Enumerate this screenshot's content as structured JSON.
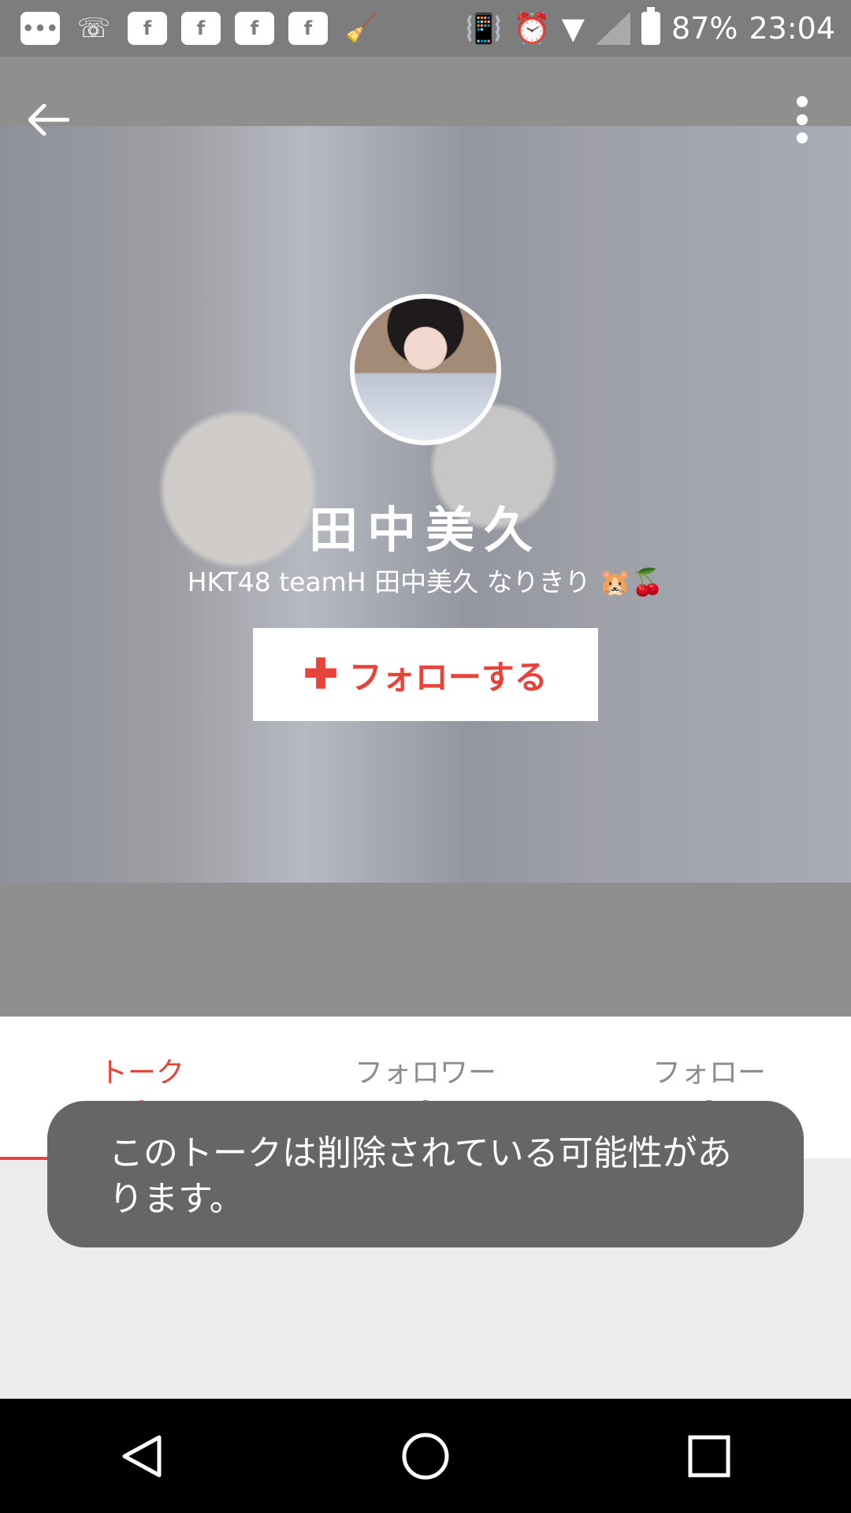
{
  "status_bar": {
    "battery": "87%",
    "time": "23:04"
  },
  "profile": {
    "name": "田中美久",
    "bio": "HKT48 teamH  田中美久 なりきり 🐹🍒",
    "follow_button": "フォローする"
  },
  "tabs": [
    {
      "label": "トーク",
      "count": "1"
    },
    {
      "label": "フォロワー",
      "count": "0"
    },
    {
      "label": "フォロー",
      "count": "0"
    }
  ],
  "toast": {
    "message": "このトークは削除されている可能性があります。"
  },
  "colors": {
    "accent": "#e84339",
    "toast_bg": "#666666",
    "header_overlay": "#8f8f8f"
  },
  "icons": [
    "back-arrow-icon",
    "more-vert-icon",
    "plus-icon",
    "nav-back-icon",
    "nav-home-icon",
    "nav-recents-icon"
  ]
}
